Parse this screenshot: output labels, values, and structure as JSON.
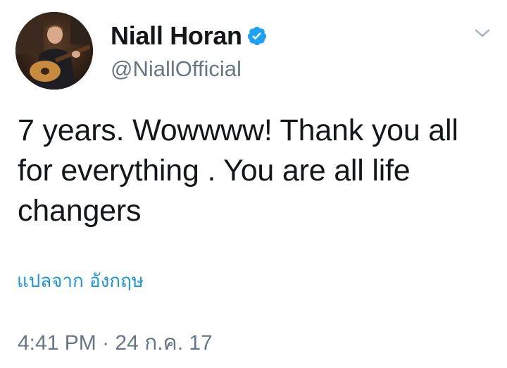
{
  "tweet": {
    "user": {
      "display_name": "Niall Horan",
      "handle": "@NiallOfficial",
      "verified": true,
      "verified_icon": "verified-badge-icon",
      "verified_color": "#1da1f2"
    },
    "text": "7 years. Wowwww! Thank you all for everything . You are all life changers",
    "translate_link": "แปลจาก อังกฤษ",
    "timestamp": {
      "time": "4:41 PM",
      "separator": "·",
      "date": "24 ก.ค. 17"
    },
    "menu_icon": "chevron-down-icon"
  },
  "colors": {
    "text": "#14171a",
    "secondary": "#657786",
    "link": "#1b95e0",
    "background": "#ffffff"
  }
}
